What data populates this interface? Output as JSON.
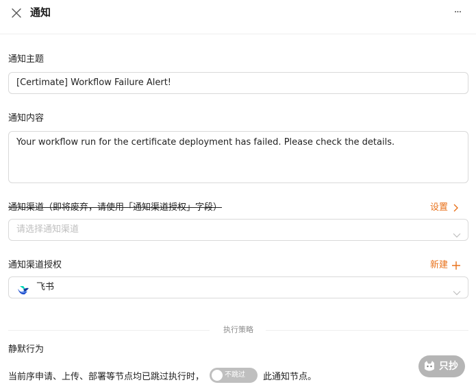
{
  "header": {
    "title": "通知",
    "more_label": "···"
  },
  "subject": {
    "label": "通知主题",
    "value": "[Certimate] Workflow Failure Alert!"
  },
  "content": {
    "label": "通知内容",
    "value": "Your workflow run for the certificate deployment has failed. Please check the details."
  },
  "channel": {
    "label": "通知渠道（即将废弃，请使用「通知渠道授权」字段）",
    "settings_link": "设置",
    "placeholder": "请选择通知渠道"
  },
  "channel_auth": {
    "label": "通知渠道授权",
    "new_link": "新建",
    "selected": "飞书"
  },
  "strategy": {
    "divider": "执行策略",
    "silent_label": "静默行为",
    "silent_prefix": "当前序申请、上传、部署等节点均已跳过执行时，",
    "toggle_text": "不跳过",
    "silent_suffix": "此通知节点。"
  },
  "watermark": {
    "text": "只抄"
  },
  "colors": {
    "accent": "#e8711a",
    "border": "#d9d9d9",
    "placeholder": "#bfbfbf",
    "toggle_off": "#bfbfbf"
  }
}
